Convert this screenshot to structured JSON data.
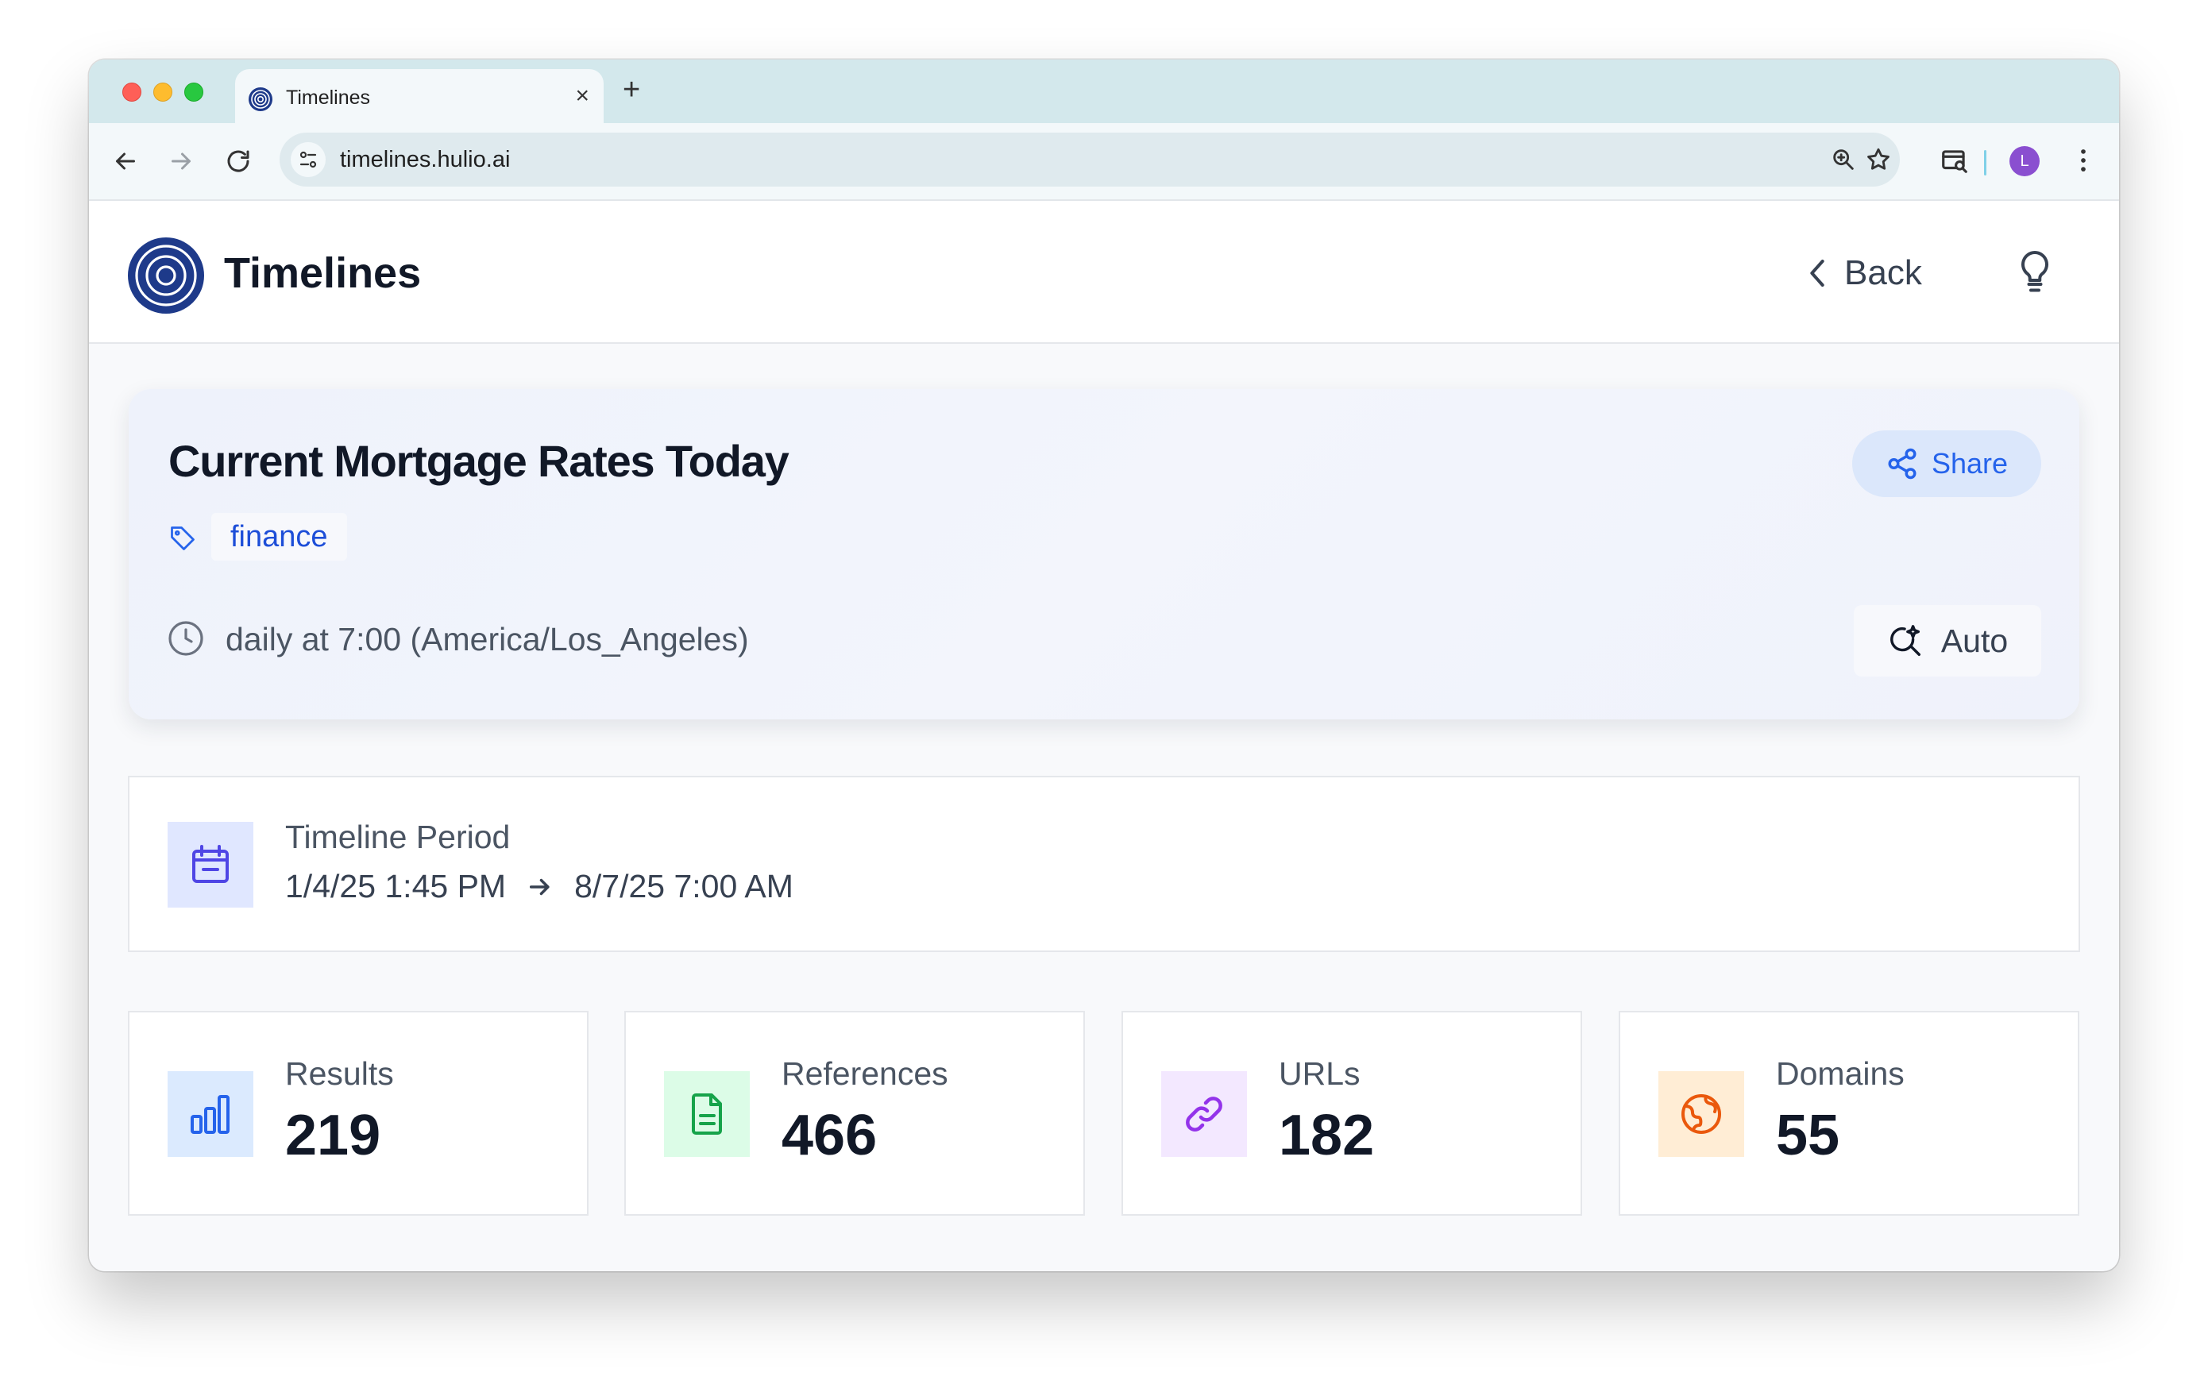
{
  "browser": {
    "tab_title": "Timelines",
    "tab_close": "×",
    "new_tab": "+",
    "url": "timelines.hulio.ai",
    "avatar_initial": "L"
  },
  "app": {
    "title": "Timelines",
    "back_label": "Back"
  },
  "timeline": {
    "title": "Current Mortgage Rates Today",
    "share_label": "Share",
    "tag": "finance",
    "schedule": "daily at 7:00 (America/Los_Angeles)",
    "mode_label": "Auto"
  },
  "period": {
    "label": "Timeline Period",
    "start": "1/4/25 1:45 PM",
    "end": "8/7/25 7:00 AM"
  },
  "stats": [
    {
      "label": "Results",
      "value": "219",
      "icon": "bar-chart-icon",
      "bg": "#dbeafe",
      "color": "#2563eb"
    },
    {
      "label": "References",
      "value": "466",
      "icon": "document-icon",
      "bg": "#dcfce7",
      "color": "#16a34a"
    },
    {
      "label": "URLs",
      "value": "182",
      "icon": "link-icon",
      "bg": "#f3e8ff",
      "color": "#9333ea"
    },
    {
      "label": "Domains",
      "value": "55",
      "icon": "globe-icon",
      "bg": "#ffedd5",
      "color": "#ea580c"
    }
  ]
}
